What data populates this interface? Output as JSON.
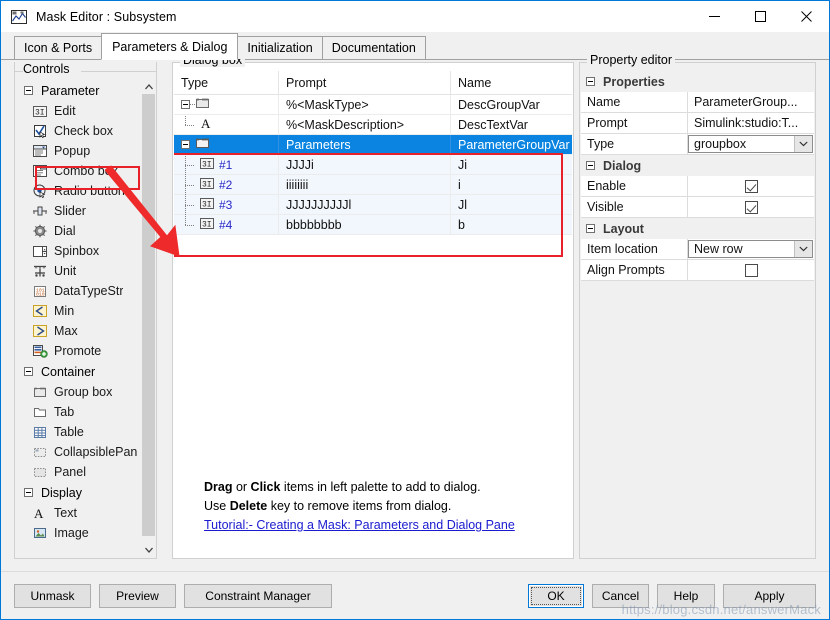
{
  "window": {
    "title": "Mask Editor : Subsystem",
    "title_icon": "mask-editor-icon",
    "minimize": "—",
    "maximize": "☐",
    "close": "✕"
  },
  "tabs": [
    {
      "label": "Icon & Ports",
      "active": false
    },
    {
      "label": "Parameters & Dialog",
      "active": true
    },
    {
      "label": "Initialization",
      "active": false
    },
    {
      "label": "Documentation",
      "active": false
    }
  ],
  "palette": {
    "legend": "Controls",
    "groups": [
      {
        "name": "Parameter",
        "items": [
          {
            "label": "Edit",
            "icon": "edit-icon",
            "highlighted": true
          },
          {
            "label": "Check box",
            "icon": "checkbox-icon"
          },
          {
            "label": "Popup",
            "icon": "popup-icon"
          },
          {
            "label": "Combo box",
            "icon": "combobox-icon"
          },
          {
            "label": "Radio button",
            "icon": "radiobutton-icon"
          },
          {
            "label": "Slider",
            "icon": "slider-icon"
          },
          {
            "label": "Dial",
            "icon": "dial-icon"
          },
          {
            "label": "Spinbox",
            "icon": "spinbox-icon"
          },
          {
            "label": "Unit",
            "icon": "unit-icon"
          },
          {
            "label": "DataTypeStr",
            "icon": "datatypestr-icon"
          },
          {
            "label": "Min",
            "icon": "min-icon"
          },
          {
            "label": "Max",
            "icon": "max-icon"
          },
          {
            "label": "Promote",
            "icon": "promote-icon"
          }
        ]
      },
      {
        "name": "Container",
        "items": [
          {
            "label": "Group box",
            "icon": "groupbox-icon"
          },
          {
            "label": "Tab",
            "icon": "tab-icon"
          },
          {
            "label": "Table",
            "icon": "table-icon"
          },
          {
            "label": "CollapsiblePan",
            "icon": "collapsiblepanel-icon"
          },
          {
            "label": "Panel",
            "icon": "panel-icon"
          }
        ]
      },
      {
        "name": "Display",
        "items": [
          {
            "label": "Text",
            "icon": "text-icon"
          },
          {
            "label": "Image",
            "icon": "image-icon"
          }
        ]
      }
    ]
  },
  "dialog_box": {
    "legend": "Dialog box",
    "columns": [
      "Type",
      "Prompt",
      "Name"
    ],
    "rows": [
      {
        "indent": 0,
        "expander": true,
        "icon": "groupbox-icon",
        "index": "",
        "prompt": "%<MaskType>",
        "name": "DescGroupVar",
        "state": "normal"
      },
      {
        "indent": 1,
        "expander": false,
        "icon": "text-icon",
        "index": "",
        "prompt": "%<MaskDescription>",
        "name": "DescTextVar",
        "state": "normal"
      },
      {
        "indent": 0,
        "expander": true,
        "icon": "groupbox-icon",
        "index": "",
        "prompt": "Parameters",
        "name": "ParameterGroupVar",
        "state": "selected"
      },
      {
        "indent": 1,
        "expander": false,
        "icon": "edit-icon",
        "index": "#1",
        "prompt": "JJJJi",
        "name": "Ji",
        "state": "child"
      },
      {
        "indent": 1,
        "expander": false,
        "icon": "edit-icon",
        "index": "#2",
        "prompt": "iiiiiiii",
        "name": "i",
        "state": "child"
      },
      {
        "indent": 1,
        "expander": false,
        "icon": "edit-icon",
        "index": "#3",
        "prompt": "JJJJJJJJJJl",
        "name": "Jl",
        "state": "child"
      },
      {
        "indent": 1,
        "expander": false,
        "icon": "edit-icon",
        "index": "#4",
        "prompt": "bbbbbbbb",
        "name": "b",
        "state": "child"
      }
    ],
    "hints": {
      "line1_a": "Drag",
      "line1_b": " or ",
      "line1_c": "Click",
      "line1_d": " items in left palette to add to dialog.",
      "line2_a": "Use ",
      "line2_b": "Delete",
      "line2_c": " key to remove items from dialog.",
      "link": "Tutorial:- Creating a Mask: Parameters and Dialog Pane"
    }
  },
  "property_editor": {
    "legend": "Property editor",
    "sections": [
      {
        "title": "Properties",
        "rows": [
          {
            "key": "Name",
            "value": "ParameterGroup...",
            "kind": "text"
          },
          {
            "key": "Prompt",
            "value": "Simulink:studio:T...",
            "kind": "text"
          },
          {
            "key": "Type",
            "value": "groupbox",
            "kind": "combo"
          }
        ]
      },
      {
        "title": "Dialog",
        "rows": [
          {
            "key": "Enable",
            "value": "checked",
            "kind": "checkbox"
          },
          {
            "key": "Visible",
            "value": "checked",
            "kind": "checkbox"
          }
        ]
      },
      {
        "title": "Layout",
        "rows": [
          {
            "key": "Item location",
            "value": "New row",
            "kind": "combo"
          },
          {
            "key": "Align Prompts",
            "value": "unchecked",
            "kind": "checkbox"
          }
        ]
      }
    ]
  },
  "footer": {
    "left_buttons": [
      {
        "label": "Unmask"
      },
      {
        "label": "Preview"
      },
      {
        "label": "Constraint Manager"
      }
    ],
    "right_buttons": [
      {
        "label": "OK",
        "default": true
      },
      {
        "label": "Cancel",
        "default": false
      },
      {
        "label": "Help",
        "default": false
      },
      {
        "label": "Apply",
        "default": false
      }
    ]
  },
  "watermark": "https://blog.csdn.net/answerMack",
  "colors": {
    "selection_blue": "#0a84e0",
    "annotation_red": "#e8202a",
    "child_row": "#f2f7fd",
    "link_blue": "#1a1ad0",
    "index_blue": "#2727c8",
    "window_border": "#0078d7"
  }
}
